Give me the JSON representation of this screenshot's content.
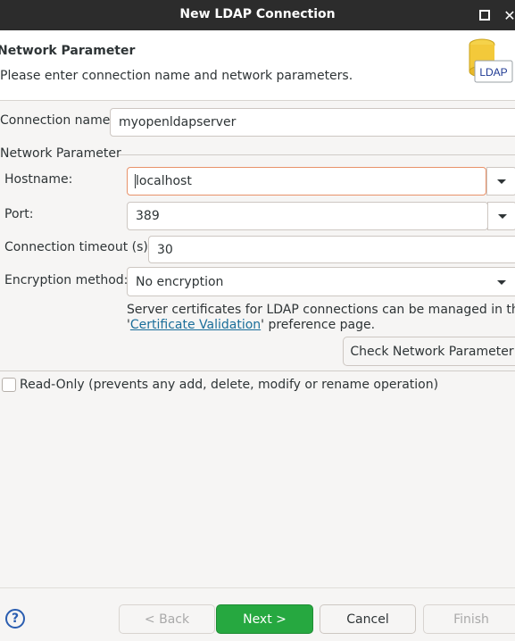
{
  "window": {
    "title": "New LDAP Connection"
  },
  "header": {
    "title": "Network Parameter",
    "description": "Please enter connection name and network parameters.",
    "icon_text": "LDAP"
  },
  "form": {
    "connection_name_label": "Connection name:",
    "connection_name_value": "myopenldapserver",
    "group_label": "Network Parameter",
    "hostname_label": "Hostname:",
    "hostname_value": "localhost",
    "port_label": "Port:",
    "port_value": "389",
    "timeout_label": "Connection timeout (s):",
    "timeout_value": "30",
    "encryption_label": "Encryption method:",
    "encryption_value": "No encryption",
    "cert_info_line1": "Server certificates for LDAP connections can be managed in the",
    "cert_info_prefix": "'",
    "cert_link": "Certificate Validation",
    "cert_info_suffix": "' preference page.",
    "check_button": "Check Network Parameter",
    "readonly_label": "Read-Only (prevents any add, delete, modify or rename operation)"
  },
  "footer": {
    "help_icon": "?",
    "back": "< Back",
    "next": "Next >",
    "cancel": "Cancel",
    "finish": "Finish"
  },
  "colors": {
    "titlebar": "#2c2c2c",
    "primary_button": "#26a840",
    "focus_border": "#e8926a",
    "link": "#1a6e9a"
  }
}
